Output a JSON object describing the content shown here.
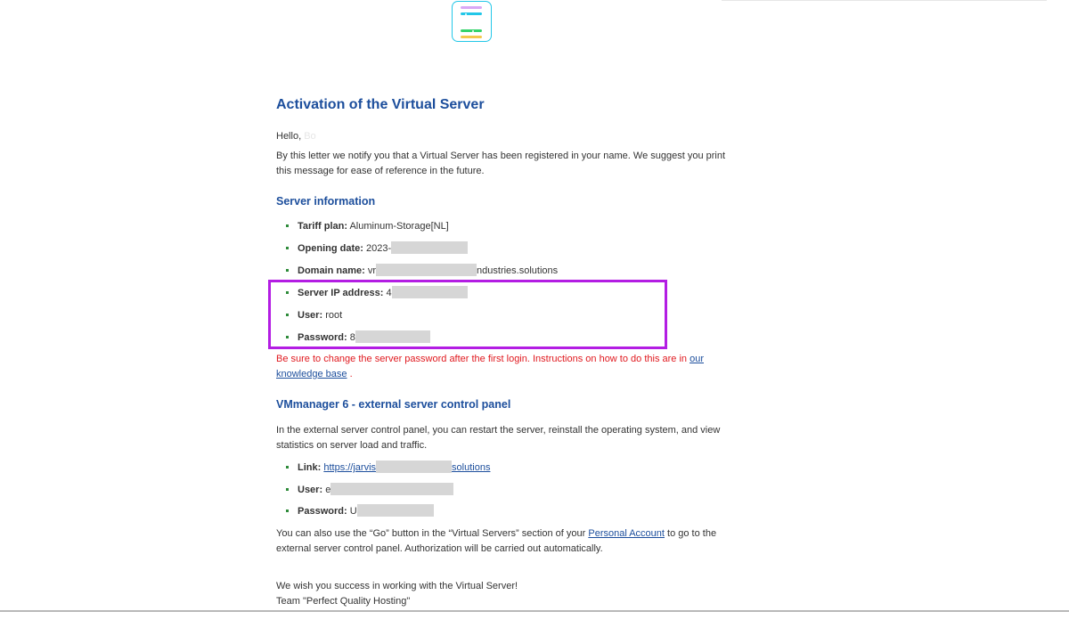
{
  "email": {
    "title": "Activation of the Virtual Server",
    "greeting": "Hello,",
    "greeting_name": "Bo",
    "intro": "By this letter we notify you that a Virtual Server has been registered in your name. We suggest you print this message for ease of reference in the future.",
    "server_info": {
      "heading": "Server information",
      "tariff_label": "Tariff plan:",
      "tariff_value": "Aluminum-Storage[NL]",
      "opening_label": "Opening date:",
      "opening_value": "2023-",
      "domain_label": "Domain name:",
      "domain_prefix": "vr",
      "domain_suffix": "ndustries.solutions",
      "ip_label": "Server IP address:",
      "ip_value": "4",
      "user_label": "User:",
      "user_value": "root",
      "password_label": "Password:",
      "password_value": "8"
    },
    "warning": {
      "text": "Be sure to change the server password after the first login. Instructions on how to do this are in ",
      "link": "our knowledge base",
      "end": " ."
    },
    "panel": {
      "heading": "VMmanager 6 - external server control panel",
      "intro": "In the external server control panel, you can restart the server, reinstall the operating system, and view statistics on server load and traffic.",
      "link_label": "Link:",
      "link_prefix": "https://jarvis",
      "link_suffix": "solutions",
      "user_label": "User:",
      "user_value": "e",
      "password_label": "Password:",
      "password_value": "U"
    },
    "also": {
      "before": "You can also use the “Go” button in the “Virtual Servers” section of your ",
      "link": "Personal Account",
      "after": " to go to the external server control panel. Authorization will be carried out automatically."
    },
    "closing": "We wish you success in working with the Virtual Server!",
    "signature": "Team \"Perfect Quality Hosting\""
  },
  "colors": {
    "heading": "#1c4e9c",
    "warning": "#e0191f",
    "highlight_box": "#b31de3",
    "bullet": "#2e8b3a"
  }
}
